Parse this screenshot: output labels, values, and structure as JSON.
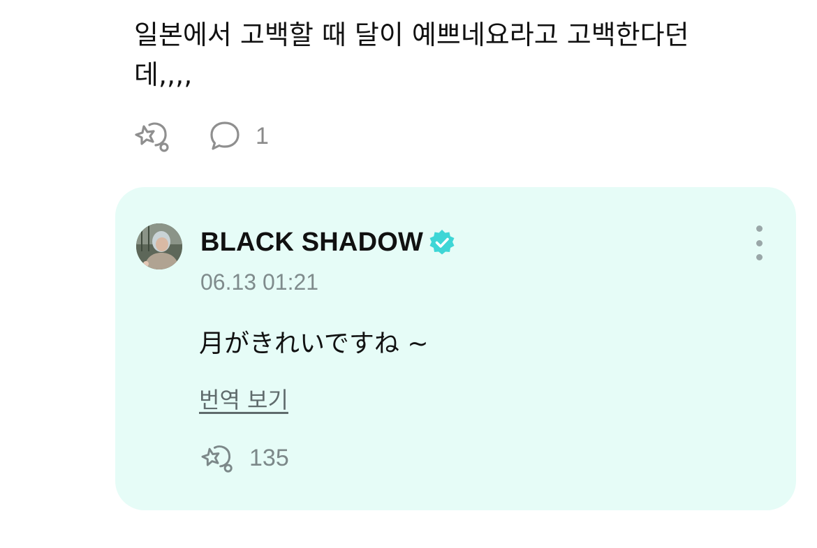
{
  "post": {
    "text": "일본에서 고백할 때 달이 예쁘네요라고 고백한다던\n데,,,,",
    "comment_count": "1",
    "icons": {
      "cheer": "cheer-icon",
      "comment": "comment-bubble-icon"
    }
  },
  "reply": {
    "author": "BLACK SHADOW",
    "verified": true,
    "timestamp": "06.13 01:21",
    "text": "月がきれいですね ~",
    "translate_label": "번역 보기",
    "cheer_count": "135",
    "background_color": "#e6fcf7",
    "verified_color": "#3ed6d6",
    "icons": {
      "avatar": "artist-avatar",
      "more": "more-vertical-icon",
      "cheer": "cheer-icon"
    }
  }
}
